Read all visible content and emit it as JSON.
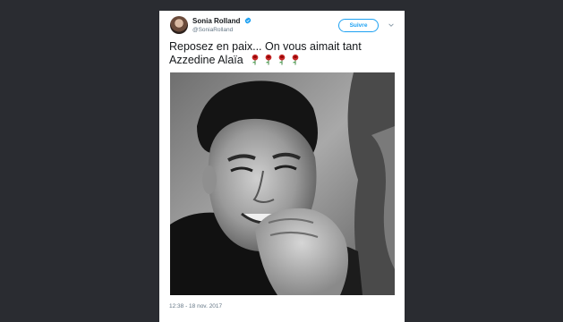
{
  "tweet": {
    "display_name": "Sonia Rolland",
    "handle": "@SoniaRolland",
    "follow_label": "Suivre",
    "text_line1": "Reposez en paix... On vous aimait tant",
    "text_line2": "Azzedine Alaïa",
    "emoji": [
      "rose-emoji",
      "rose-emoji",
      "rose-emoji",
      "rose-emoji"
    ],
    "timestamp": "12:38 - 18 nov. 2017"
  },
  "colors": {
    "page_background": "#2a2c31",
    "card_background": "#ffffff",
    "accent": "#1da1f2",
    "text_primary": "#14171a",
    "text_secondary": "#657786"
  },
  "icons": {
    "verified": "verified-badge-icon",
    "menu": "chevron-down-icon"
  }
}
